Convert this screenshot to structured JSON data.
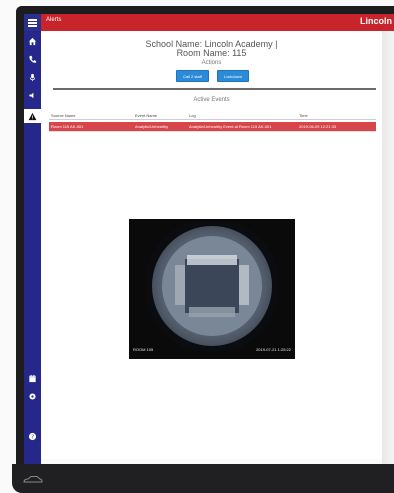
{
  "topbar": {
    "title": "Alerts",
    "brand": "Lincoln"
  },
  "sidebar": {
    "items": [
      {
        "icon": "home-icon"
      },
      {
        "icon": "phone-icon"
      },
      {
        "icon": "microphone-icon"
      },
      {
        "icon": "speaker-icon"
      },
      {
        "icon": "alert-triangle-icon",
        "active": true
      },
      {
        "icon": "calendar-icon"
      },
      {
        "icon": "gear-icon"
      },
      {
        "icon": "help-icon"
      }
    ]
  },
  "header": {
    "school": "School Name: Lincoln Academy |",
    "room": "Room Name: 115",
    "actions_label": "Actions"
  },
  "buttons": {
    "call": "Call 2 staff",
    "lockdown": "Lockdown"
  },
  "events": {
    "title": "Active Events",
    "columns": [
      "Source Name",
      "Event Name",
      "Log",
      "Time"
    ],
    "rows": [
      [
        "Room 115 AK-001",
        "Analytic/Unhealthy",
        "Analytic/Unhealthy Event at Room 115 AK-001",
        "2019-06-09 12:21:33"
      ]
    ]
  },
  "camera": {
    "room_label": "ROOM 105",
    "timestamp": "2019-07-21 1:25:22"
  },
  "colors": {
    "header_red": "#c8242b",
    "sidebar_navy": "#25288a",
    "button_blue": "#2b8bd8",
    "event_row_red": "#d6464b"
  }
}
